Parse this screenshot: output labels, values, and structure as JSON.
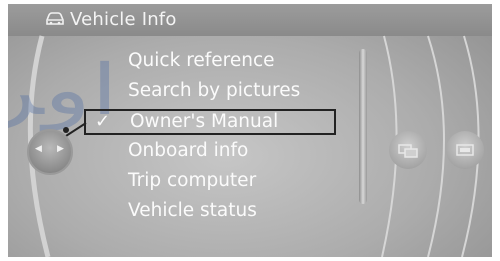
{
  "header": {
    "title": "Vehicle Info"
  },
  "menu": {
    "items": [
      {
        "label": "Quick reference",
        "selected": false
      },
      {
        "label": "Search by pictures",
        "selected": false
      },
      {
        "label": "Owner's Manual",
        "selected": true
      },
      {
        "label": "Onboard info",
        "selected": false
      },
      {
        "label": "Trip computer",
        "selected": false
      },
      {
        "label": "Vehicle status",
        "selected": false
      }
    ],
    "check_glyph": "✓"
  },
  "controller": {
    "left_arrow": "◀",
    "right_arrow": "▶"
  },
  "icons": {
    "title": "car-icon",
    "right_button_1": "vehicle-status-icon",
    "right_button_2": "display-icon"
  },
  "colors": {
    "screen": "#acacac",
    "header": "#8f8f8f",
    "text": "#fbfbfb",
    "selection_border": "#222222"
  }
}
